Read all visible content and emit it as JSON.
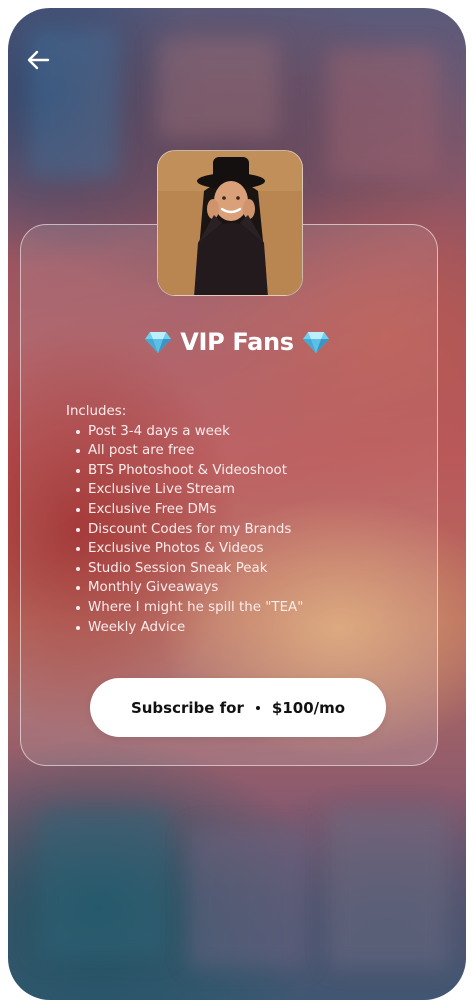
{
  "header": {
    "back_icon": "arrow-left-icon"
  },
  "profile": {
    "photo": "creator-avatar"
  },
  "tier": {
    "title": "VIP Fans",
    "title_icon": "diamond-icon",
    "includes_label": "Includes:",
    "perks": [
      "Post 3-4 days a week",
      "All post are free",
      "BTS Photoshoot & Videoshoot",
      "Exclusive Live Stream",
      "Exclusive Free DMs",
      "Discount Codes for my Brands",
      "Exclusive Photos & Videos",
      "Studio Session Sneak Peak",
      "Monthly Giveaways",
      "Where I might he spill the \"TEA\"",
      "Weekly Advice"
    ]
  },
  "subscribe": {
    "label": "Subscribe for",
    "price": "$100/mo"
  },
  "colors": {
    "button_bg": "#ffffff",
    "text": "#ffffff",
    "gem": "#5fc4e8"
  }
}
